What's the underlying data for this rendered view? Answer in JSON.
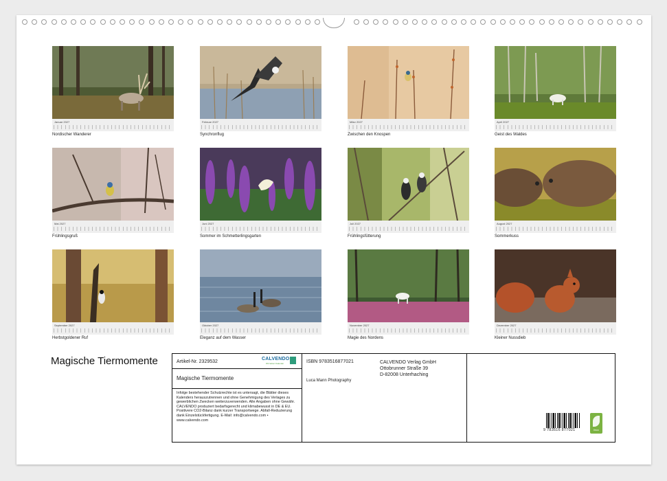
{
  "calendar_title": "Magische Tiermomente",
  "months": [
    {
      "label": "Januar 2027",
      "caption": "Nordischer Wanderer",
      "scene": "reindeer-forest"
    },
    {
      "label": "Februar 2027",
      "caption": "Synchronflug",
      "scene": "birds-reeds"
    },
    {
      "label": "März 2027",
      "caption": "Zwischen den Knospen",
      "scene": "bird-twigs"
    },
    {
      "label": "April 2027",
      "caption": "Geist des Waldes",
      "scene": "white-reindeer-forest"
    },
    {
      "label": "Mai 2027",
      "caption": "Frühlingsgruß",
      "scene": "bluetit-branch"
    },
    {
      "label": "Juni 2027",
      "caption": "Sommer im Schmetterlingsgarten",
      "scene": "butterfly-lavender"
    },
    {
      "label": "Juli 2027",
      "caption": "Frühlingsfütterung",
      "scene": "great-tits"
    },
    {
      "label": "August 2027",
      "caption": "Sommerkuss",
      "scene": "nutrias"
    },
    {
      "label": "September 2027",
      "caption": "Herbstgoldener Ruf",
      "scene": "woodpecker-pine"
    },
    {
      "label": "Oktober 2027",
      "caption": "Eleganz auf dem Wasser",
      "scene": "geese-water"
    },
    {
      "label": "November 2027",
      "caption": "Magie des Nordens",
      "scene": "white-deer-heather"
    },
    {
      "label": "Dezember 2027",
      "caption": "Kleiner Nussdieb",
      "scene": "red-squirrel"
    }
  ],
  "info": {
    "artikel": "Artikel-Nr. 2329532",
    "calvendo_logo": "CALVENDO",
    "calvendo_sub": "Wir lieben Kalender",
    "title": "Magische Tiermomente",
    "legal": "Infolge bestehender Schutzrechte ist es untersagt, die Blätter dieses Kalenders herauszutrennen und ohne Genehmigung des Verlages zu gewerblichen Zwecken weiterzuverwenden. Alle Angaben ohne Gewähr. CALVENDO produziert bedarfsgerecht und klimabewusst in DE & EU. Positivere CO2-Bilanz dank kurzer Transportwege. Abfall-Reduzierung dank Einzelstückfertigung. E-Mail: info@calvendo.com • www.calvendo.com",
    "isbn": "ISBN 9783516877021",
    "photographer": "Luca Mann Photography",
    "publisher_name": "CALVENDO Verlag GmbH",
    "publisher_street": "Ottobrunner Straße 39",
    "publisher_city": "D-82008 Unterhaching",
    "barcode_number": "9 783516 877021",
    "feco_label": "feco"
  }
}
